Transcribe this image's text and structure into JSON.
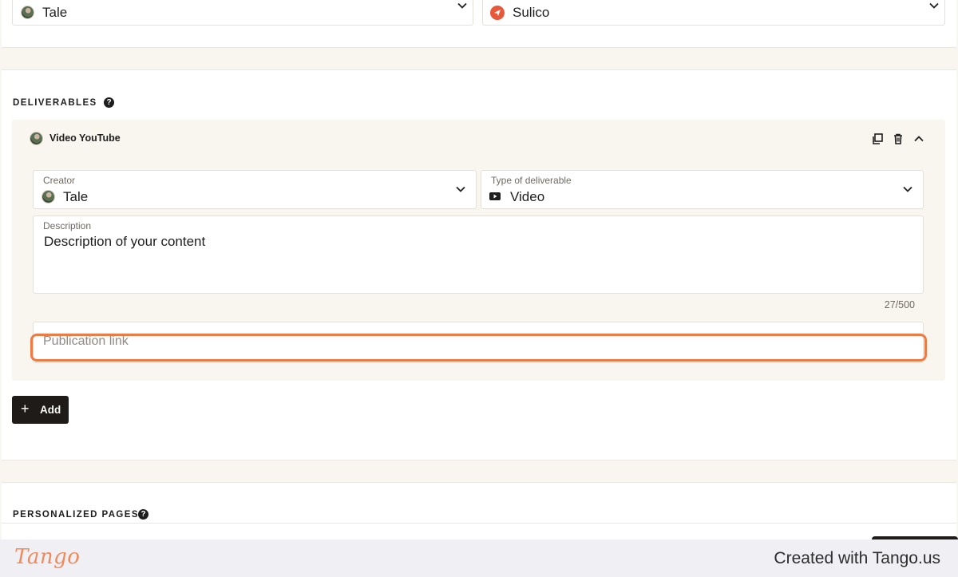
{
  "top": {
    "creator_value": "Tale",
    "brand_value": "Sulico"
  },
  "deliverables": {
    "title": "DELIVERABLES",
    "help_icon": "?",
    "item": {
      "name": "Video YouTube",
      "creator_label": "Creator",
      "creator_value": "Tale",
      "type_label": "Type of deliverable",
      "type_value": "Video",
      "description_label": "Description",
      "description_value": "Description of your content",
      "counter": "27/500",
      "publication_placeholder": "Publication link"
    },
    "add_label": "Add",
    "add_icon": "+"
  },
  "personalized": {
    "title": "PERSONALIZED PAGES",
    "help_icon": "?"
  },
  "footer": {
    "logo": "Tango",
    "created_text": "Created with Tango.us"
  },
  "colors": {
    "accent": "#f07a45",
    "background": "#f9f5ef",
    "button": "#1e1b18"
  }
}
